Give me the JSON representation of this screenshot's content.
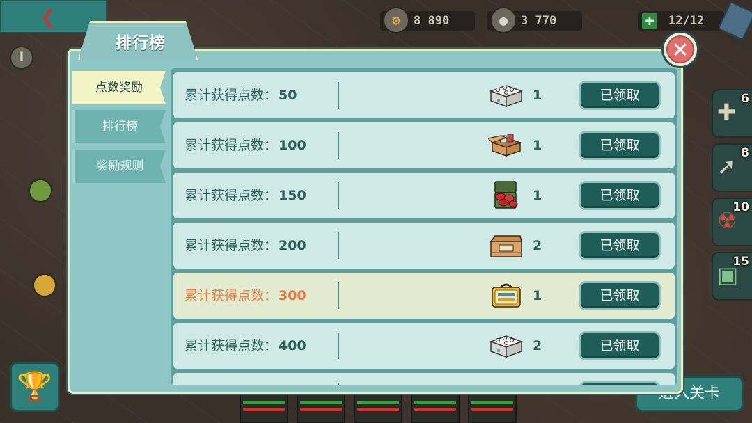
{
  "hud": {
    "parts": "8 890",
    "coins": "3 770",
    "energy": "12/12",
    "side_items": [
      {
        "name": "medkit",
        "count": "6"
      },
      {
        "name": "syringe",
        "count": "8"
      },
      {
        "name": "radiation-pack",
        "count": "10"
      },
      {
        "name": "radar",
        "count": "15"
      }
    ],
    "enter_level": "进入关卡"
  },
  "dialog": {
    "title": "排行榜",
    "tabs": [
      {
        "label": "点数奖励",
        "active": true
      },
      {
        "label": "排行榜",
        "active": false
      },
      {
        "label": "奖励规则",
        "active": false
      }
    ],
    "rewards": [
      {
        "label": "累计获得点数：",
        "points": "50",
        "item": "white-crate",
        "qty": "1",
        "button": "已领取",
        "highlight": false
      },
      {
        "label": "累计获得点数：",
        "points": "100",
        "item": "open-box",
        "qty": "1",
        "button": "已领取",
        "highlight": false
      },
      {
        "label": "累计获得点数：",
        "points": "150",
        "item": "ammo-box",
        "qty": "1",
        "button": "已领取",
        "highlight": false
      },
      {
        "label": "累计获得点数：",
        "points": "200",
        "item": "wooden-crate",
        "qty": "2",
        "button": "已领取",
        "highlight": false
      },
      {
        "label": "累计获得点数：",
        "points": "300",
        "item": "lunchbox",
        "qty": "1",
        "button": "已领取",
        "highlight": true
      },
      {
        "label": "累计获得点数：",
        "points": "400",
        "item": "white-crate",
        "qty": "2",
        "button": "已领取",
        "highlight": false
      }
    ]
  }
}
